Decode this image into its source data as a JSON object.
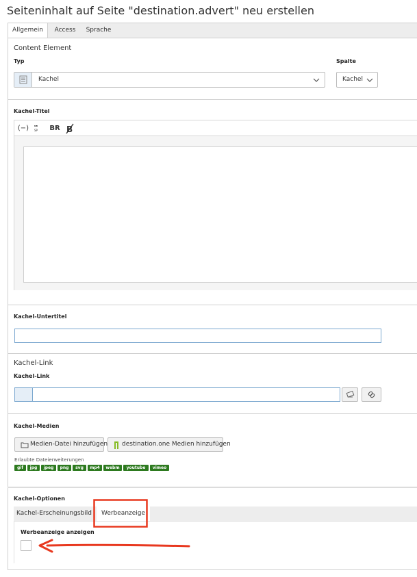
{
  "page": {
    "title": "Seiteninhalt auf Seite \"destination.advert\" neu erstellen"
  },
  "tabs": [
    {
      "label": "Allgemein",
      "active": true
    },
    {
      "label": "Access",
      "active": false
    },
    {
      "label": "Sprache",
      "active": false
    }
  ],
  "content_element": {
    "heading": "Content Element",
    "typ_label": "Typ",
    "typ_value": "Kachel",
    "spalte_label": "Spalte",
    "spalte_value": "Kachel"
  },
  "kachel_titel": {
    "label": "Kachel-Titel",
    "toolbar": [
      "(−)",
      "BR"
    ]
  },
  "kachel_untertitel": {
    "label": "Kachel-Untertitel",
    "value": ""
  },
  "kachel_link": {
    "heading": "Kachel-Link",
    "label": "Kachel-Link",
    "value": ""
  },
  "kachel_medien": {
    "label": "Kachel-Medien",
    "add_file_button": "Medien-Datei hinzufügen",
    "add_d1_button": "destination.one Medien hinzufügen",
    "allowed_label": "Erlaubte Dateierweiterungen",
    "extensions": [
      "gif",
      "jpg",
      "jpeg",
      "png",
      "svg",
      "mp4",
      "webm",
      "youtube",
      "vimeo"
    ]
  },
  "kachel_optionen": {
    "label": "Kachel-Optionen",
    "subtabs": [
      {
        "label": "Kachel-Erscheinungsbild",
        "active": false
      },
      {
        "label": "Werbeanzeige",
        "active": true
      }
    ],
    "werbe_label": "Werbeanzeige anzeigen"
  },
  "colors": {
    "accent": "#7aa7cf",
    "badge": "#2d7a1f",
    "annotation": "#e8381f"
  }
}
